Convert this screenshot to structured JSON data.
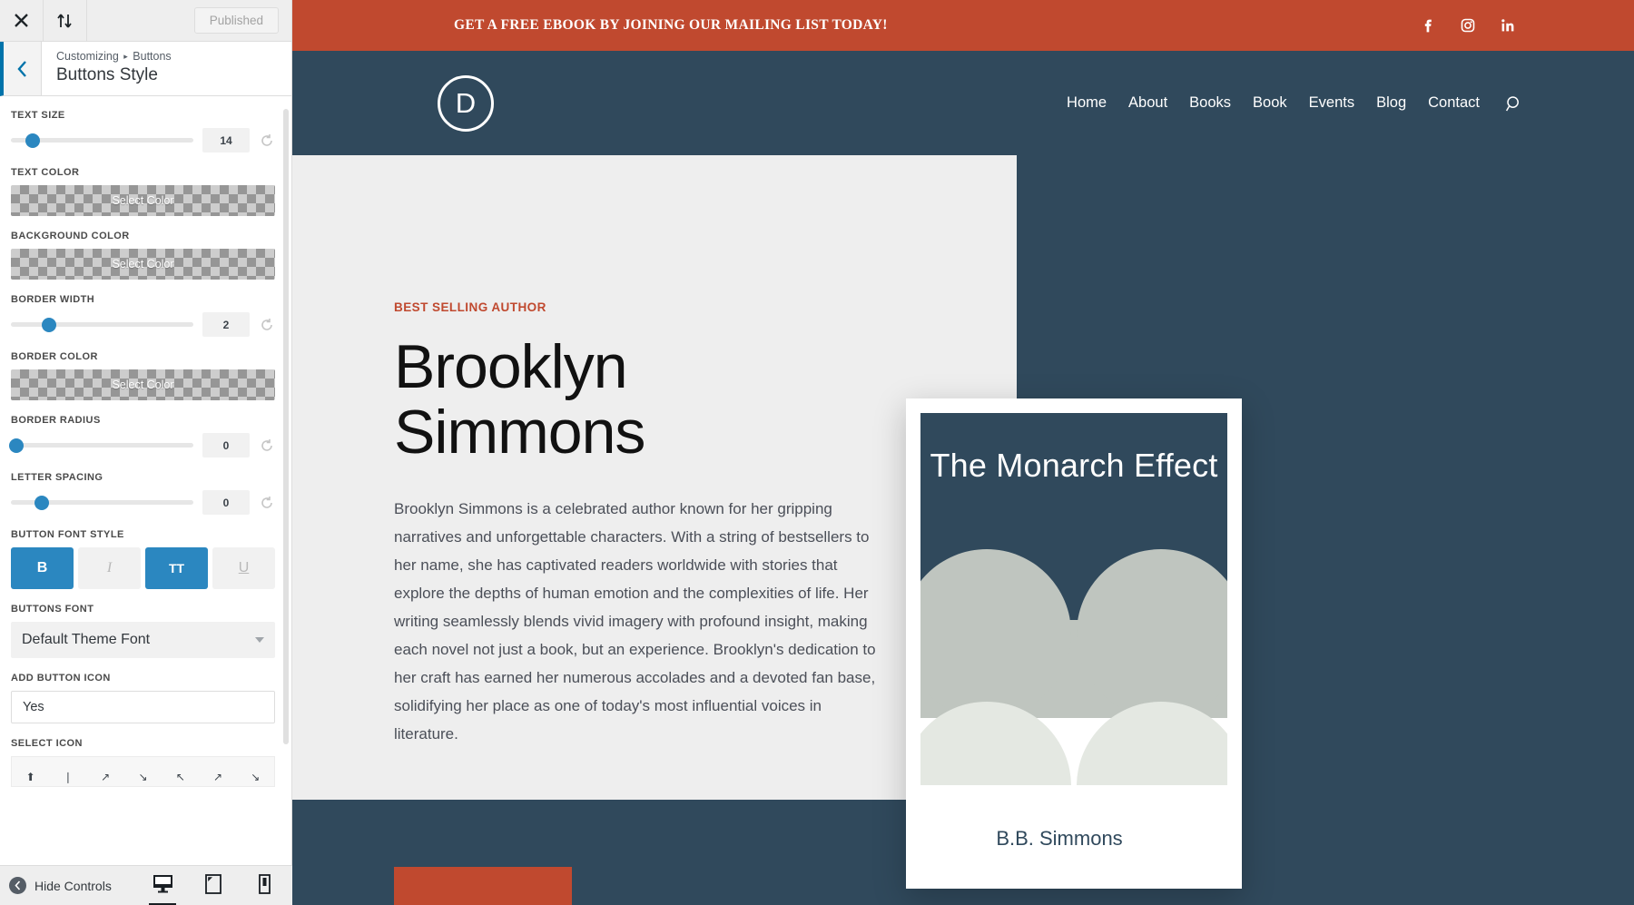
{
  "customizer": {
    "topbar": {
      "close_icon": "close-icon",
      "devices_icon": "sort-arrows-icon",
      "published_label": "Published"
    },
    "header": {
      "back_icon": "chevron-left-icon",
      "breadcrumb_root": "Customizing",
      "breadcrumb_separator": "▸",
      "breadcrumb_current": "Buttons",
      "title": "Buttons Style"
    },
    "controls": [
      {
        "label": "TEXT SIZE",
        "type": "slider",
        "value": "14",
        "knob_pct": 12
      },
      {
        "label": "TEXT COLOR",
        "type": "color",
        "value": "Select Color"
      },
      {
        "label": "BACKGROUND COLOR",
        "type": "color",
        "value": "Select Color"
      },
      {
        "label": "BORDER WIDTH",
        "type": "slider",
        "value": "2",
        "knob_pct": 21
      },
      {
        "label": "BORDER COLOR",
        "type": "color",
        "value": "Select Color"
      },
      {
        "label": "BORDER RADIUS",
        "type": "slider",
        "value": "0",
        "knob_pct": 3
      },
      {
        "label": "LETTER SPACING",
        "type": "slider",
        "value": "0",
        "knob_pct": 17
      }
    ],
    "font_style": {
      "label": "BUTTON FONT STYLE",
      "buttons": [
        {
          "name": "bold",
          "glyph": "B",
          "active": true
        },
        {
          "name": "italic",
          "glyph": "I",
          "active": false
        },
        {
          "name": "uppercase",
          "glyph": "TT",
          "active": true
        },
        {
          "name": "underline",
          "glyph": "U",
          "active": false
        }
      ]
    },
    "buttons_font": {
      "label": "BUTTONS FONT",
      "value": "Default Theme Font"
    },
    "add_button_icon": {
      "label": "ADD BUTTON ICON",
      "value": "Yes"
    },
    "select_icon": {
      "label": "SELECT ICON",
      "glyphs": [
        "⬆",
        "❘",
        "↗",
        "↘",
        "↖",
        "↗",
        "↘"
      ]
    },
    "footer": {
      "hide_controls_label": "Hide Controls",
      "devices": [
        {
          "name": "desktop-view-button",
          "icon": "desktop-icon",
          "active": true
        },
        {
          "name": "tablet-view-button",
          "icon": "tablet-icon",
          "active": false
        },
        {
          "name": "mobile-view-button",
          "icon": "mobile-icon",
          "active": false
        }
      ]
    }
  },
  "site": {
    "announcement": {
      "text": "GET A FREE EBOOK BY JOINING OUR MAILING LIST TODAY!",
      "background": "#c0492f",
      "socials": [
        "facebook-icon",
        "instagram-icon",
        "linkedin-icon"
      ]
    },
    "nav": {
      "background": "#30495c",
      "logo_letter": "D",
      "links": [
        "Home",
        "About",
        "Books",
        "Book",
        "Events",
        "Blog",
        "Contact"
      ],
      "search_icon": "search-icon"
    },
    "hero": {
      "eyebrow": "BEST SELLING AUTHOR",
      "eyebrow_color": "#c0492f",
      "title": "Brooklyn Simmons",
      "paragraph": "Brooklyn Simmons is a celebrated author known for her gripping narratives and unforgettable characters. With a string of bestsellers to her name, she has captivated readers worldwide with stories that explore the depths of human emotion and the complexities of life. Her writing seamlessly blends vivid imagery with profound insight, making each novel not just a book, but an experience. Brooklyn's dedication to her craft has earned her numerous accolades and a devoted fan base, solidifying her place as one of today's most influential voices in literature.",
      "background_light": "#eeeeee",
      "background_dark": "#30495c"
    },
    "book_cover": {
      "title": "The Monarch Effect",
      "author": "B.B. Simmons",
      "navy": "#30495c",
      "wing_upper": "#bfc5bf",
      "wing_lower": "#e4e8e2"
    }
  }
}
